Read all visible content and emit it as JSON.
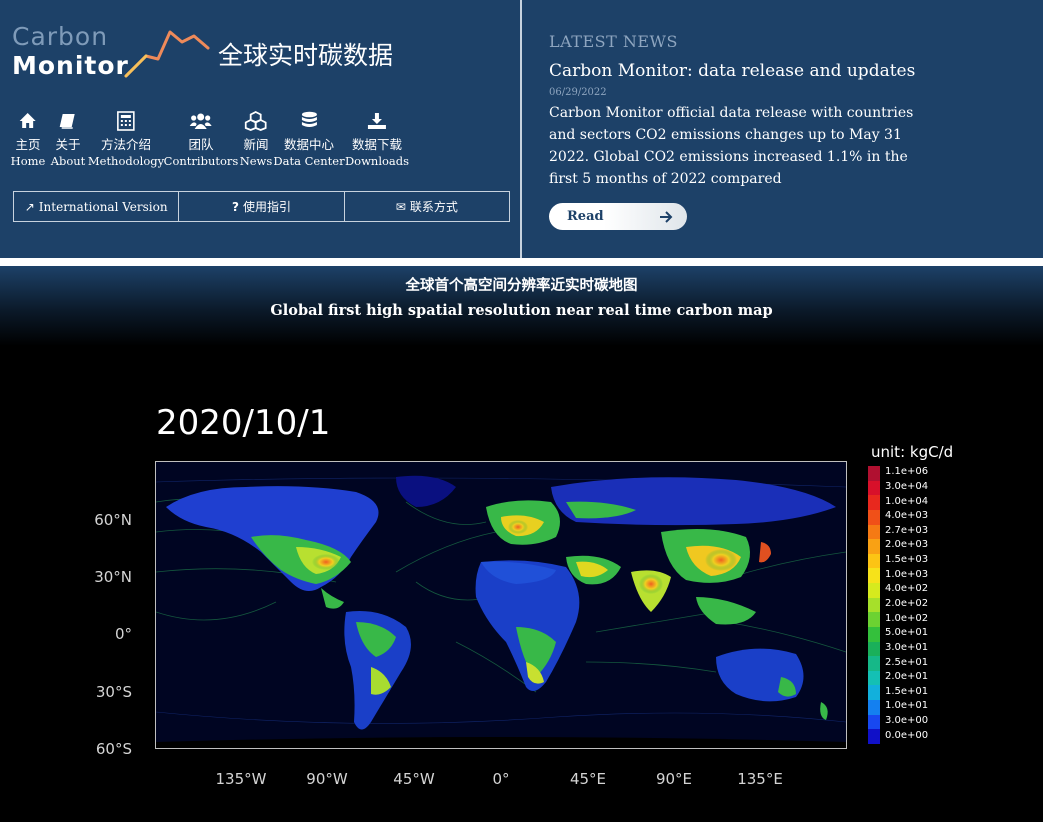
{
  "logo": {
    "line1": "Carbon",
    "line2": "Monitor",
    "cn_title": "全球实时碳数据"
  },
  "nav": [
    {
      "cn": "主页",
      "en": "Home",
      "icon": "home-icon"
    },
    {
      "cn": "关于",
      "en": "About",
      "icon": "book-icon"
    },
    {
      "cn": "方法介绍",
      "en": "Methodology",
      "icon": "calculator-icon"
    },
    {
      "cn": "团队",
      "en": "Contributors",
      "icon": "users-icon"
    },
    {
      "cn": "新闻",
      "en": "News",
      "icon": "cubes-icon"
    },
    {
      "cn": "数据中心",
      "en": "Data Center",
      "icon": "database-icon"
    },
    {
      "cn": "数据下载",
      "en": "Downloads",
      "icon": "download-icon"
    }
  ],
  "buttons": {
    "international": "International Version",
    "guide": "使用指引",
    "contact": "联系方式"
  },
  "news": {
    "heading": "LATEST NEWS",
    "title": "Carbon Monitor: data release and updates",
    "date": "06/29/2022",
    "body": "Carbon Monitor official data release with countries and sectors CO2 emissions changes up to May 31 2022. Global CO2 emissions increased 1.1% in the first 5 months of 2022 compared",
    "read": "Read"
  },
  "banner": {
    "cn": "全球首个高空间分辨率近实时碳地图",
    "en": "Global first high spatial resolution near real time carbon map"
  },
  "map": {
    "date": "2020/10/1",
    "unit": "unit: kgC/d",
    "lat_labels": [
      "60°N",
      "30°N",
      "0°",
      "30°S",
      "60°S"
    ],
    "lon_labels": [
      "135°W",
      "90°W",
      "45°W",
      "0°",
      "45°E",
      "90°E",
      "135°E"
    ],
    "legend": [
      {
        "label": "1.1e+06",
        "color": "#b01030"
      },
      {
        "label": "3.0e+04",
        "color": "#d8102a"
      },
      {
        "label": "1.0e+04",
        "color": "#e8281e"
      },
      {
        "label": "4.0e+03",
        "color": "#f05018"
      },
      {
        "label": "2.7e+03",
        "color": "#f57a14"
      },
      {
        "label": "2.0e+03",
        "color": "#f9a114"
      },
      {
        "label": "1.5e+03",
        "color": "#fcc414"
      },
      {
        "label": "1.0e+03",
        "color": "#f6e21a"
      },
      {
        "label": "4.0e+02",
        "color": "#d6ea1e"
      },
      {
        "label": "2.0e+02",
        "color": "#a6e02a"
      },
      {
        "label": "1.0e+02",
        "color": "#6cd232"
      },
      {
        "label": "5.0e+01",
        "color": "#34c03c"
      },
      {
        "label": "3.0e+01",
        "color": "#1ab05a"
      },
      {
        "label": "2.5e+01",
        "color": "#16b888"
      },
      {
        "label": "2.0e+01",
        "color": "#14c0b4"
      },
      {
        "label": "1.5e+01",
        "color": "#12b0dc"
      },
      {
        "label": "1.0e+01",
        "color": "#1480f0"
      },
      {
        "label": "3.0e+00",
        "color": "#1848f0"
      },
      {
        "label": "0.0e+00",
        "color": "#1010c8"
      }
    ]
  }
}
